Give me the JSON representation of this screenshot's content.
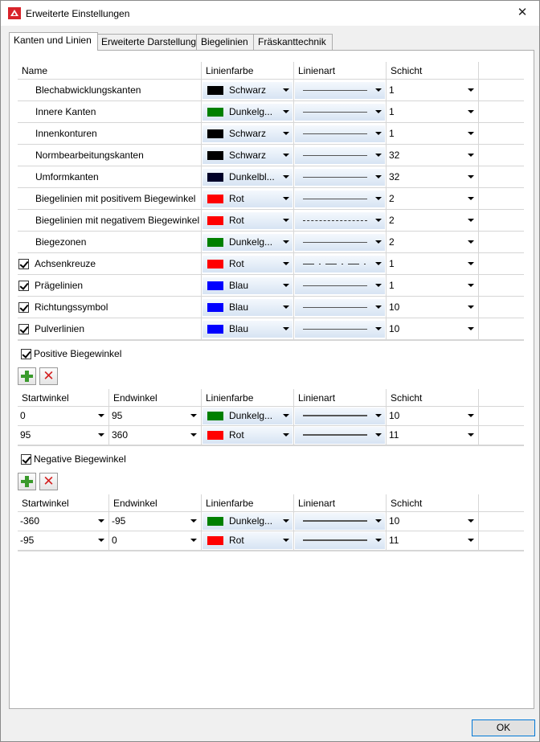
{
  "window": {
    "title": "Erweiterte Einstellungen",
    "close_symbol": "✕"
  },
  "tabs": [
    "Kanten und Linien",
    "Erweiterte Darstellung",
    "Biegelinien",
    "Fräskanttechnik"
  ],
  "colors": {
    "Schwarz": "#000000",
    "Dunkelgrün": "#008000",
    "Dunkelblau": "#000028",
    "Rot": "#ff0000",
    "Blau": "#0000ff"
  },
  "main_table": {
    "headers": [
      "Name",
      "Linienfarbe",
      "Linienart",
      "Schicht"
    ],
    "rows": [
      {
        "name": "Blechabwicklungskanten",
        "checkbox": false,
        "color_name": "Schwarz",
        "color": "#000000",
        "linestyle": "solid",
        "layer": "1"
      },
      {
        "name": "Innere Kanten",
        "checkbox": false,
        "color_name": "Dunkelg...",
        "color": "#008000",
        "linestyle": "solid",
        "layer": "1"
      },
      {
        "name": "Innenkonturen",
        "checkbox": false,
        "color_name": "Schwarz",
        "color": "#000000",
        "linestyle": "solid",
        "layer": "1"
      },
      {
        "name": "Normbearbeitungskanten",
        "checkbox": false,
        "color_name": "Schwarz",
        "color": "#000000",
        "linestyle": "solid",
        "layer": "32"
      },
      {
        "name": "Umformkanten",
        "checkbox": false,
        "color_name": "Dunkelbl...",
        "color": "#000028",
        "linestyle": "solid",
        "layer": "32"
      },
      {
        "name": "Biegelinien mit positivem Biegewinkel",
        "checkbox": false,
        "color_name": "Rot",
        "color": "#ff0000",
        "linestyle": "solid",
        "layer": "2"
      },
      {
        "name": "Biegelinien mit negativem Biegewinkel",
        "checkbox": false,
        "color_name": "Rot",
        "color": "#ff0000",
        "linestyle": "dashed",
        "layer": "2"
      },
      {
        "name": "Biegezonen",
        "checkbox": false,
        "color_name": "Dunkelg...",
        "color": "#008000",
        "linestyle": "solid",
        "layer": "2"
      },
      {
        "name": "Achsenkreuze",
        "checkbox": true,
        "color_name": "Rot",
        "color": "#ff0000",
        "linestyle": "dashdot",
        "layer": "1"
      },
      {
        "name": "Prägelinien",
        "checkbox": true,
        "color_name": "Blau",
        "color": "#0000ff",
        "linestyle": "solid",
        "layer": "1"
      },
      {
        "name": "Richtungssymbol",
        "checkbox": true,
        "color_name": "Blau",
        "color": "#0000ff",
        "linestyle": "solid",
        "layer": "10"
      },
      {
        "name": "Pulverlinien",
        "checkbox": true,
        "color_name": "Blau",
        "color": "#0000ff",
        "linestyle": "solid",
        "layer": "10"
      }
    ]
  },
  "positive": {
    "label": "Positive Biegewinkel",
    "checked": true,
    "headers": [
      "Startwinkel",
      "Endwinkel",
      "Linienfarbe",
      "Linienart",
      "Schicht"
    ],
    "rows": [
      {
        "start": "0",
        "end": "95",
        "color_name": "Dunkelg...",
        "color": "#008000",
        "layer": "10"
      },
      {
        "start": "95",
        "end": "360",
        "color_name": "Rot",
        "color": "#ff0000",
        "layer": "11"
      }
    ]
  },
  "negative": {
    "label": "Negative Biegewinkel",
    "checked": true,
    "headers": [
      "Startwinkel",
      "Endwinkel",
      "Linienfarbe",
      "Linienart",
      "Schicht"
    ],
    "rows": [
      {
        "start": "-360",
        "end": "-95",
        "color_name": "Dunkelg...",
        "color": "#008000",
        "layer": "10"
      },
      {
        "start": "-95",
        "end": "0",
        "color_name": "Rot",
        "color": "#ff0000",
        "layer": "11"
      }
    ]
  },
  "buttons": {
    "ok": "OK"
  }
}
